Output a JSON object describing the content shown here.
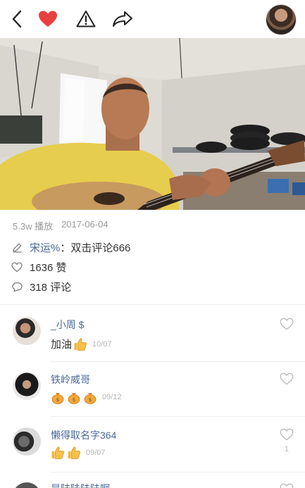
{
  "topbar": {
    "back_icon": "chevron-left-icon",
    "like_icon": "heart-filled-icon",
    "report_icon": "warning-icon",
    "share_icon": "share-arrow-icon",
    "like_color": "#e8403f"
  },
  "video": {
    "plays": "5.3w 播放",
    "date": "2017-06-04"
  },
  "post": {
    "author": "宋运%",
    "caption_sep": "：",
    "caption": "双击评论666",
    "likes": "1636 赞",
    "comments": "318 评论"
  },
  "comments": [
    {
      "name": "_小周 $",
      "text": "加油",
      "emoji": [
        "thumbs-up"
      ],
      "date": "10/07",
      "like_count": ""
    },
    {
      "name": "铁岭威哥",
      "text": "",
      "emoji": [
        "moneybag",
        "moneybag",
        "moneybag"
      ],
      "date": "09/12",
      "like_count": ""
    },
    {
      "name": "懒得取名字364",
      "text": "",
      "emoji": [
        "thumbs-up",
        "thumbs-up"
      ],
      "date": "09/07",
      "like_count": "1"
    },
    {
      "name": "是陆陆陆陆啊",
      "text": "",
      "emoji": [],
      "date": "",
      "like_count": ""
    }
  ]
}
